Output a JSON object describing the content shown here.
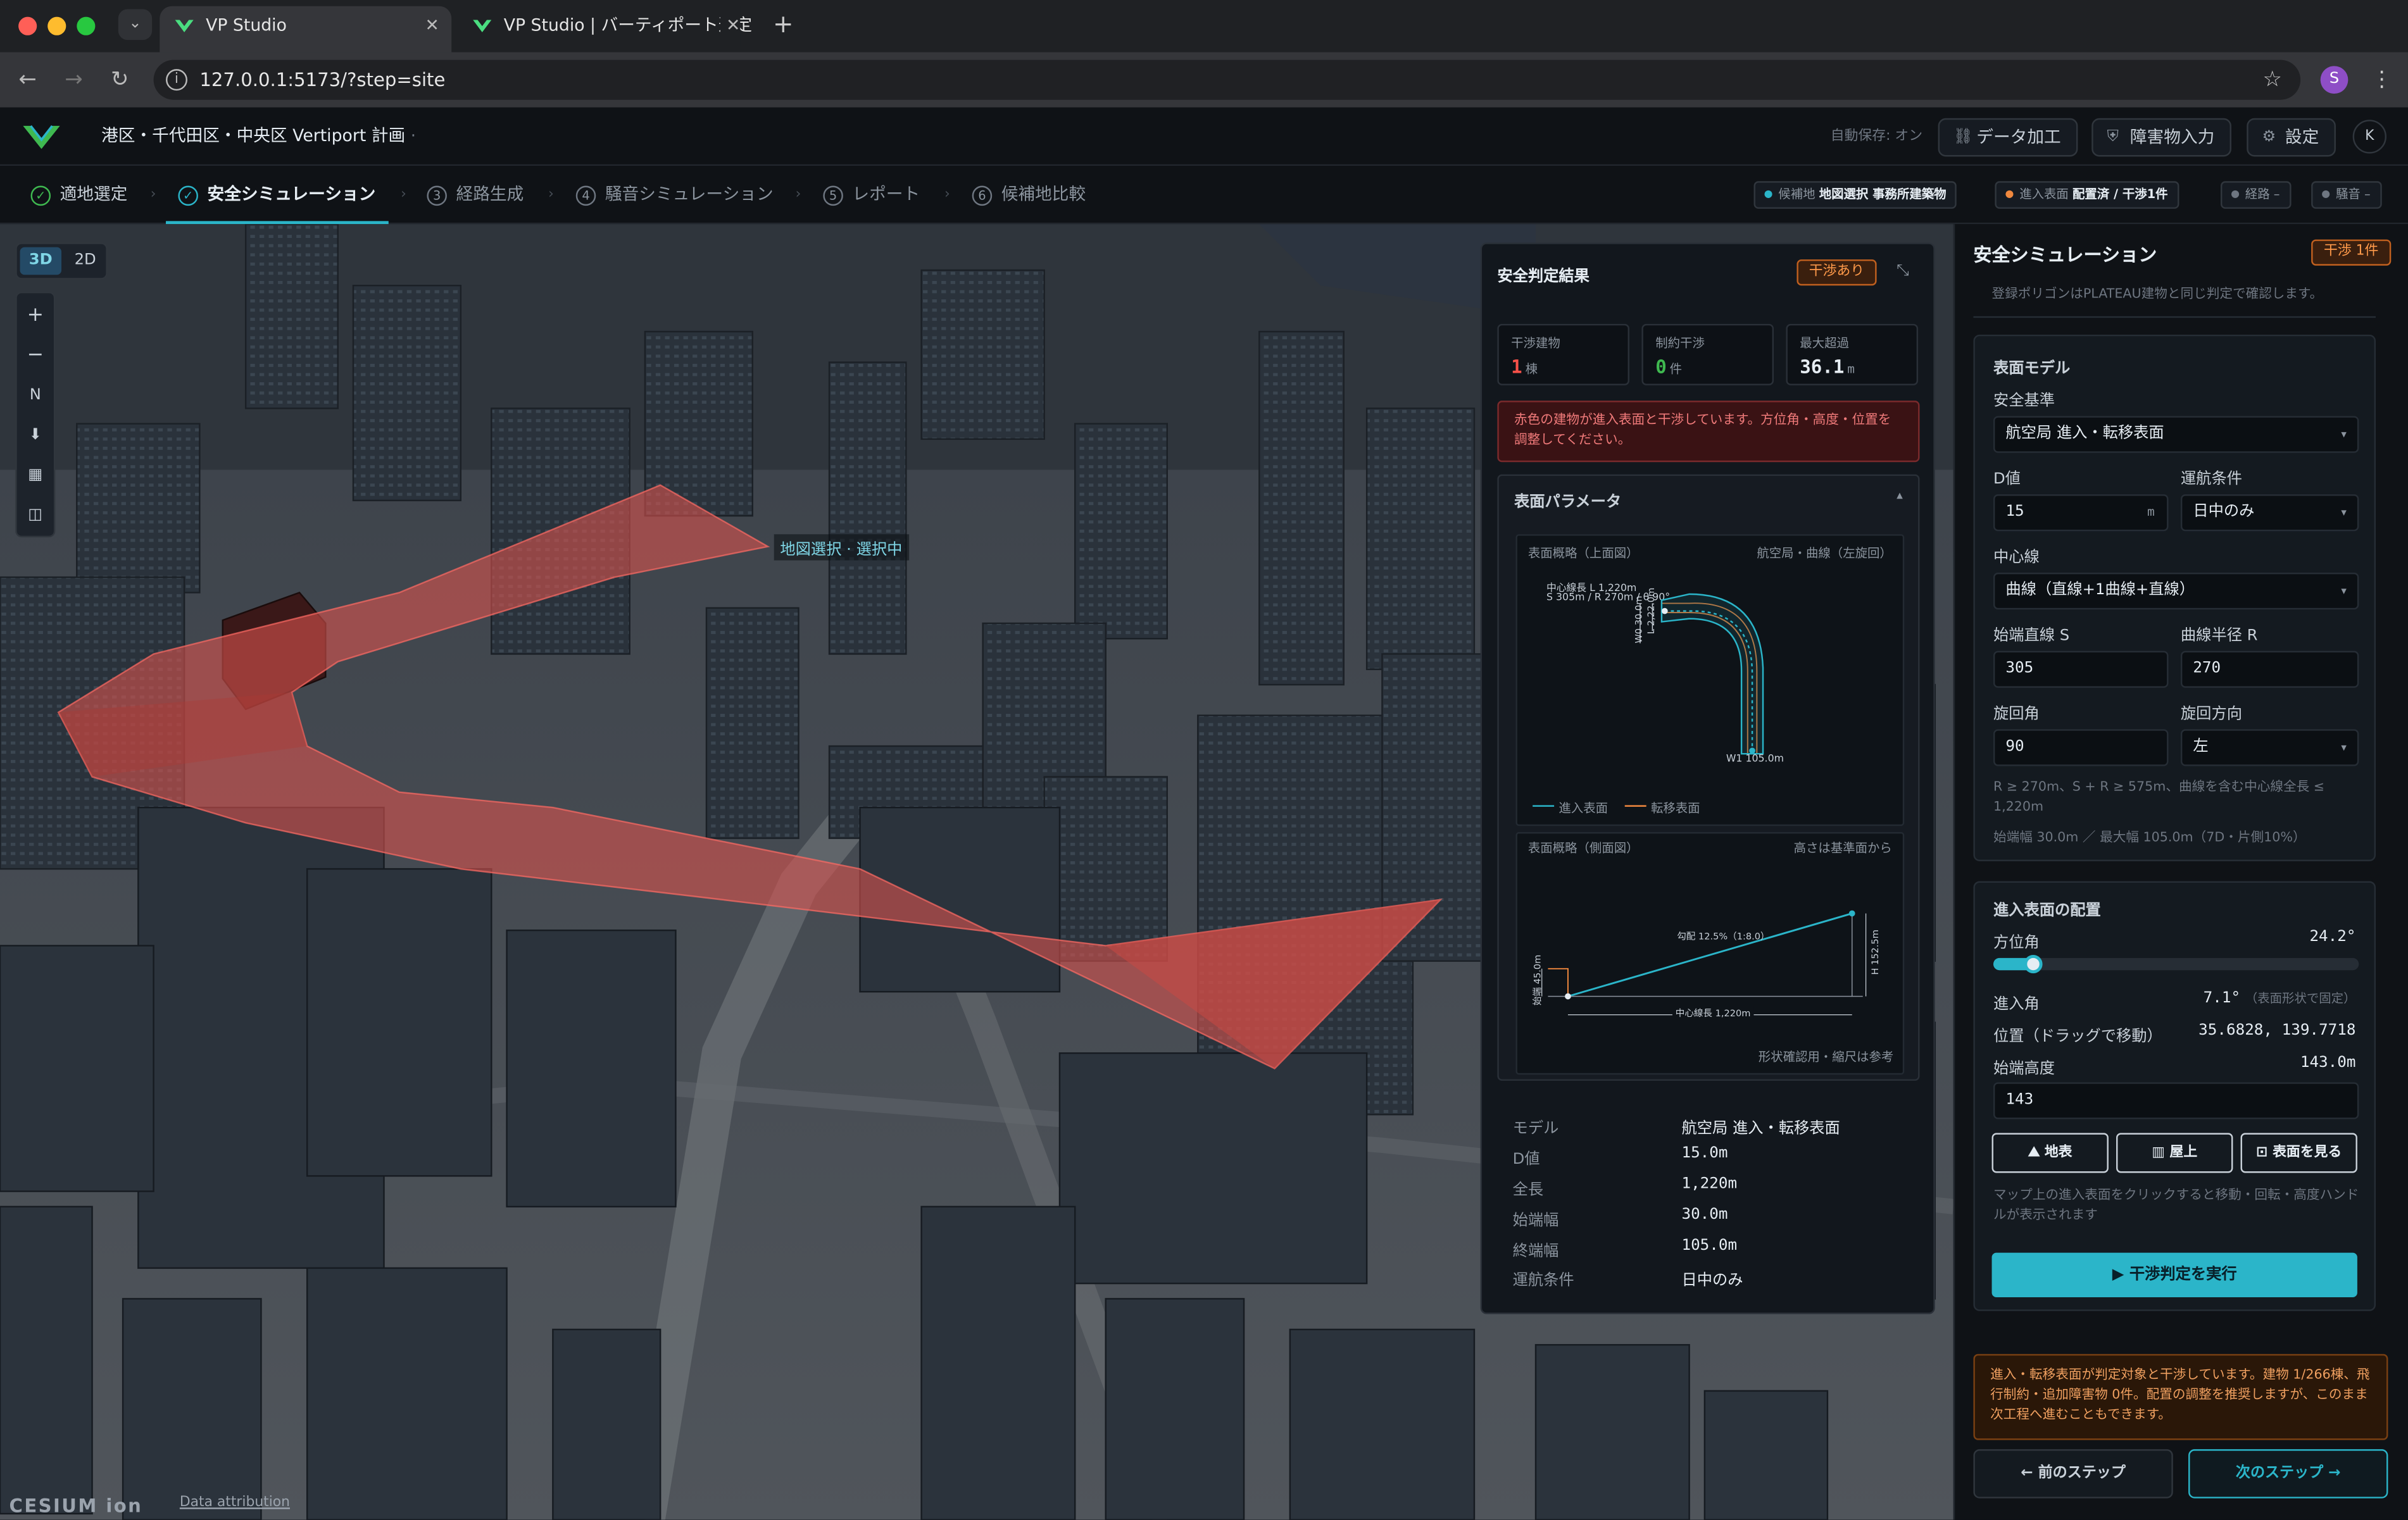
{
  "browser": {
    "tabs": [
      {
        "title": "VP Studio",
        "close": "✕"
      },
      {
        "title": "VP Studio | バーティポート選定",
        "close": "✕"
      }
    ],
    "new_tab": "+",
    "url": "127.0.0.1:5173/?step=site",
    "profile_initial": "S"
  },
  "header": {
    "project_title": "港区・千代田区・中央区 Vertiport 計画",
    "title_caret": "·",
    "autosave": "自動保存: オン",
    "buttons": [
      "データ加工",
      "障害物入力",
      "設定"
    ],
    "avatar": "K"
  },
  "steps": [
    {
      "label": "適地選定",
      "num": "✓"
    },
    {
      "label": "安全シミュレーション",
      "num": "✓"
    },
    {
      "label": "経路生成",
      "num": "3"
    },
    {
      "label": "騒音シミュレーション",
      "num": "4"
    },
    {
      "label": "レポート",
      "num": "5"
    },
    {
      "label": "候補地比較",
      "num": "6"
    }
  ],
  "step_sep": "›",
  "status_chips": [
    {
      "label": "候補地",
      "value": "地図選択 事務所建築物",
      "color": "#2bb5c9"
    },
    {
      "label": "進入表面",
      "value": "配置済 / 干渉1件",
      "color": "#f0883e"
    },
    {
      "label": "経路",
      "value": "–",
      "color": "#6e7681"
    },
    {
      "label": "騒音",
      "value": "–",
      "color": "#6e7681"
    }
  ],
  "map": {
    "mode_3d": "3D",
    "mode_2d": "2D",
    "tools": [
      "+",
      "−",
      "N",
      "⬇",
      "▦",
      "◫"
    ],
    "overlay_label": "地図選択 · 選択中",
    "cesium": "CESIUM ion",
    "attribution": "Data attribution"
  },
  "result": {
    "title": "安全判定結果",
    "badge": "干渉あり",
    "collapse_icon": "⤡",
    "stats": [
      {
        "label": "干渉建物",
        "value": "1",
        "unit": "棟",
        "color": "#f85149"
      },
      {
        "label": "制約干渉",
        "value": "0",
        "unit": "件",
        "color": "#3fb950"
      },
      {
        "label": "最大超過",
        "value": "36.1",
        "unit": "m",
        "color": "#e6edf3"
      }
    ],
    "alert": "赤色の建物が進入表面と干渉しています。方位角・高度・位置を調整してください。",
    "params_title": "表面パラメータ",
    "params_chevron": "▴",
    "plan": {
      "title": "表面概略（上面図）",
      "right": "航空局・曲線（左旋回）",
      "centerline": "中心線長 L 1,220m",
      "formula": "S 305m / R 270m / θ 90°",
      "w0": "W0 30.0m",
      "l": "L 2,22.0m",
      "w1": "W1 105.0m",
      "legend_approach": "進入表面",
      "legend_transition": "転移表面"
    },
    "profile": {
      "title": "表面概略（側面図）",
      "right": "高さは基準面から",
      "slope": "勾配 12.5%（1:8.0）",
      "height": "H 152.5m",
      "start": "始端 45.0m",
      "length": "中心線長 1,220m",
      "foot": "形状確認用・縮尺は参考"
    },
    "details": [
      {
        "k": "モデル",
        "v": "航空局 進入・転移表面"
      },
      {
        "k": "D値",
        "v": "15.0m"
      },
      {
        "k": "全長",
        "v": "1,220m"
      },
      {
        "k": "始端幅",
        "v": "30.0m"
      },
      {
        "k": "終端幅",
        "v": "105.0m"
      },
      {
        "k": "運航条件",
        "v": "日中のみ"
      }
    ]
  },
  "panel": {
    "title": "安全シミュレーション",
    "badge": "干渉 1件",
    "top_note": "登録ポリゴンはPLATEAU建物と同じ判定で確認します。",
    "surface_model": {
      "title": "表面モデル",
      "safety_label": "安全基準",
      "safety_value": "航空局 進入・転移表面",
      "d_label": "D値",
      "d_value": "15",
      "d_unit": "m",
      "ops_label": "運航条件",
      "ops_value": "日中のみ",
      "center_label": "中心線",
      "center_value": "曲線（直線+1曲線+直線）",
      "s_label": "始端直線 S",
      "s_value": "305",
      "r_label": "曲線半径 R",
      "r_value": "270",
      "angle_label": "旋回角",
      "angle_value": "90",
      "dir_label": "旋回方向",
      "dir_value": "左",
      "caret": "▾",
      "hint1": "R ≥ 270m、S + R ≥ 575m、曲線を含む中心線全長 ≤ 1,220m",
      "hint2": "始端幅 30.0m ／ 最大幅 105.0m（7D・片側10%）"
    },
    "placement": {
      "title": "進入表面の配置",
      "azimuth_label": "方位角",
      "azimuth_value": "24.2°",
      "azimuth_fraction": 0.067,
      "approach_label": "進入角",
      "approach_value": "7.1°",
      "approach_note": "（表面形状で固定）",
      "pos_label": "位置（ドラッグで移動）",
      "pos_value": "35.6828, 139.7718",
      "alt_label": "始端高度",
      "alt_value": "143.0m",
      "alt_input": "143",
      "btn_ground": "地表",
      "btn_roof": "屋上",
      "btn_view": "表面を見る",
      "hint": "マップ上の進入表面をクリックすると移動・回転・高度ハンドルが表示されます",
      "run": "▶ 干渉判定を実行"
    },
    "warning": "進入・転移表面が判定対象と干渉しています。建物 1/266棟、飛行制約・追加障害物 0件。配置の調整を推奨しますが、このまま次工程へ進むこともできます。",
    "prev": "← 前のステップ",
    "next": "次のステップ →"
  }
}
